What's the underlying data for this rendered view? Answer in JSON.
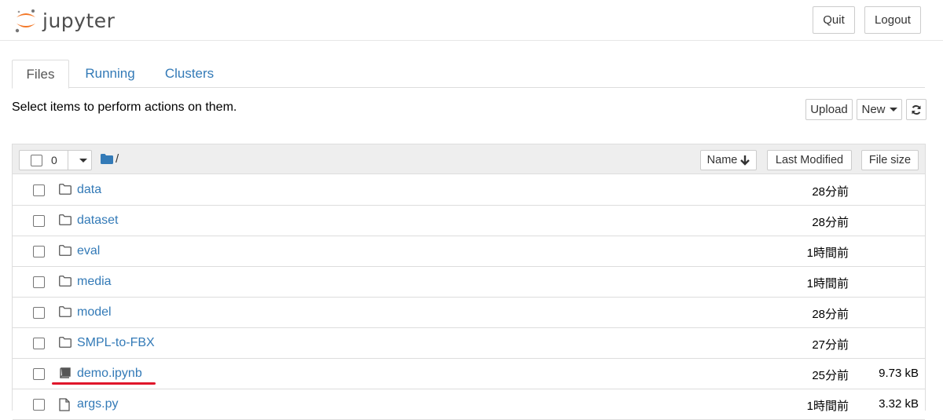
{
  "app": {
    "logo_text": "jupyter"
  },
  "header": {
    "quit_label": "Quit",
    "logout_label": "Logout"
  },
  "tabs": [
    {
      "label": "Files"
    },
    {
      "label": "Running"
    },
    {
      "label": "Clusters"
    }
  ],
  "toolbar": {
    "instructions": "Select items to perform actions on them.",
    "upload_label": "Upload",
    "new_label": "New"
  },
  "list_header": {
    "selected_count": "0",
    "path": "/",
    "name_label": "Name",
    "last_modified_label": "Last Modified",
    "file_size_label": "File size"
  },
  "files": [
    {
      "name": "data",
      "type": "folder",
      "modified": "28分前",
      "size": ""
    },
    {
      "name": "dataset",
      "type": "folder",
      "modified": "28分前",
      "size": ""
    },
    {
      "name": "eval",
      "type": "folder",
      "modified": "1時間前",
      "size": ""
    },
    {
      "name": "media",
      "type": "folder",
      "modified": "1時間前",
      "size": ""
    },
    {
      "name": "model",
      "type": "folder",
      "modified": "28分前",
      "size": ""
    },
    {
      "name": "SMPL-to-FBX",
      "type": "folder",
      "modified": "27分前",
      "size": ""
    },
    {
      "name": "demo.ipynb",
      "type": "notebook",
      "modified": "25分前",
      "size": "9.73 kB"
    },
    {
      "name": "args.py",
      "type": "file",
      "modified": "1時間前",
      "size": "3.32 kB"
    }
  ],
  "colors": {
    "link": "#337ab7",
    "highlight_underline": "#e0162b",
    "logo_orange": "#f37726"
  }
}
